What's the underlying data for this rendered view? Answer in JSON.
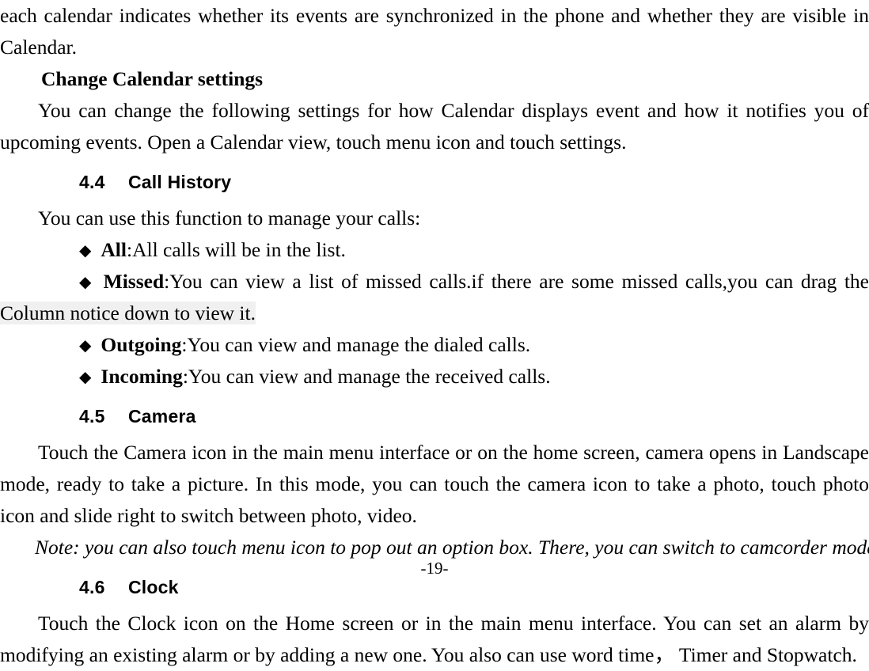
{
  "document": {
    "page_number_label": "-19-",
    "bullet_glyph": "◆",
    "highlight_color": "#f0f0f0",
    "text_color": "#000000"
  },
  "calendar_section": {
    "continued_paragraph": "each calendar indicates whether its events are synchronized in the phone and whether they are visible in Calendar.",
    "subheading": "Change Calendar settings",
    "body_paragraph": "You can change the following settings for how Calendar displays event and how it notifies you of upcoming events. Open a Calendar view, touch menu icon and touch settings."
  },
  "call_history_section": {
    "number": "4.4",
    "title": "Call History",
    "intro": "You can use this function to manage your calls:",
    "items": [
      {
        "term": "All",
        "separator": ":",
        "description": "All calls will be in the list.",
        "highlighted_tail": ""
      },
      {
        "term": "Missed",
        "separator": ":",
        "description": "You can view a list of missed calls.if there are some missed calls,you can drag the ",
        "highlighted_tail": "Column notice down to view it."
      },
      {
        "term": "Outgoing",
        "separator": ":",
        "description": "You can view and manage the dialed calls.",
        "highlighted_tail": ""
      },
      {
        "term": "Incoming",
        "separator": ":",
        "description": "You can view and manage the received calls.",
        "highlighted_tail": ""
      }
    ]
  },
  "camera_section": {
    "number": "4.5",
    "title": "Camera",
    "body_paragraph": "Touch the Camera icon in the main menu interface or on the home screen, camera opens in Landscape mode, ready to take a picture. In this mode, you can touch the camera icon to take a photo, touch photo icon and slide right to switch between photo, video.",
    "note": "Note: you can also touch menu icon to pop out an option box. There, you can switch to camcorder mode."
  },
  "clock_section": {
    "number": "4.6",
    "title": "Clock",
    "body_paragraph": "Touch the Clock icon on the Home screen or in the main menu interface. You can set an alarm by modifying an existing alarm or by adding a new one. You also can use word time， Timer and Stopwatch."
  }
}
